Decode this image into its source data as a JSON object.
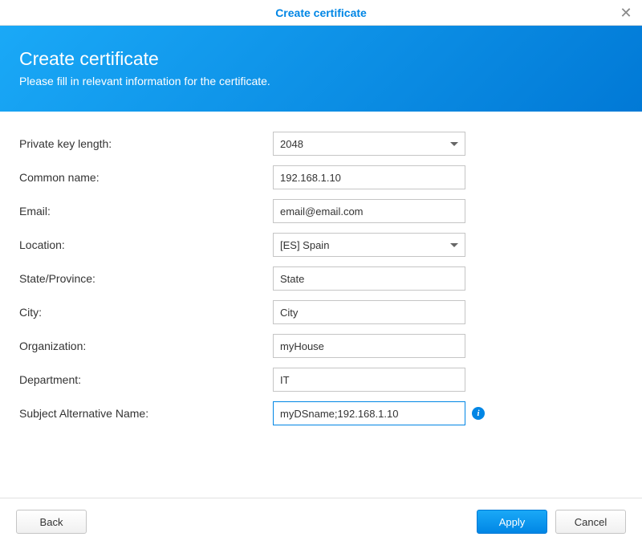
{
  "titlebar": {
    "title": "Create certificate"
  },
  "banner": {
    "title": "Create certificate",
    "subtitle": "Please fill in relevant information for the certificate."
  },
  "form": {
    "fields": [
      {
        "label": "Private key length:",
        "type": "select",
        "value": "2048",
        "name": "private-key-length"
      },
      {
        "label": "Common name:",
        "type": "text",
        "value": "192.168.1.10",
        "name": "common-name"
      },
      {
        "label": "Email:",
        "type": "text",
        "value": "email@email.com",
        "name": "email"
      },
      {
        "label": "Location:",
        "type": "select",
        "value": "[ES] Spain",
        "name": "location"
      },
      {
        "label": "State/Province:",
        "type": "text",
        "value": "State",
        "name": "state-province"
      },
      {
        "label": "City:",
        "type": "text",
        "value": "City",
        "name": "city"
      },
      {
        "label": "Organization:",
        "type": "text",
        "value": "myHouse",
        "name": "organization"
      },
      {
        "label": "Department:",
        "type": "text",
        "value": "IT",
        "name": "department"
      },
      {
        "label": "Subject Alternative Name:",
        "type": "text",
        "value": "myDSname;192.168.1.10",
        "name": "subject-alt-name",
        "focused": true,
        "info": true
      }
    ]
  },
  "footer": {
    "back": "Back",
    "apply": "Apply",
    "cancel": "Cancel"
  }
}
